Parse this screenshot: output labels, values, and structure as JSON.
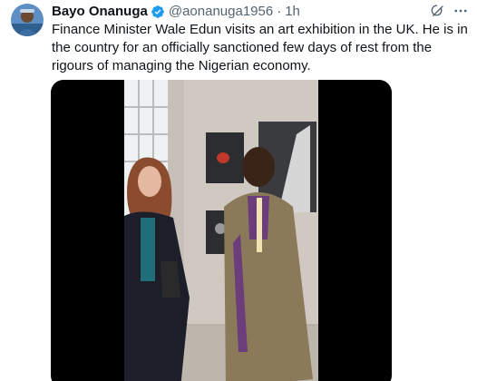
{
  "author": {
    "name": "Bayo Onanuga",
    "handle": "@aonanuga1956",
    "separator": "·",
    "time": "1h"
  },
  "tweet": {
    "text": "Finance Minister Wale Edun visits an art exhibition in the UK. He is in the country for an officially sanctioned few days of rest from the rigours of managing the Nigerian economy."
  },
  "icons": {
    "verified": "verified-badge-icon",
    "grok": "grok-icon",
    "more": "more-options-icon"
  },
  "colors": {
    "verified": "#1d9bf0",
    "secondary_text": "#536471",
    "primary_text": "#0f1419",
    "media_background": "#000000"
  }
}
